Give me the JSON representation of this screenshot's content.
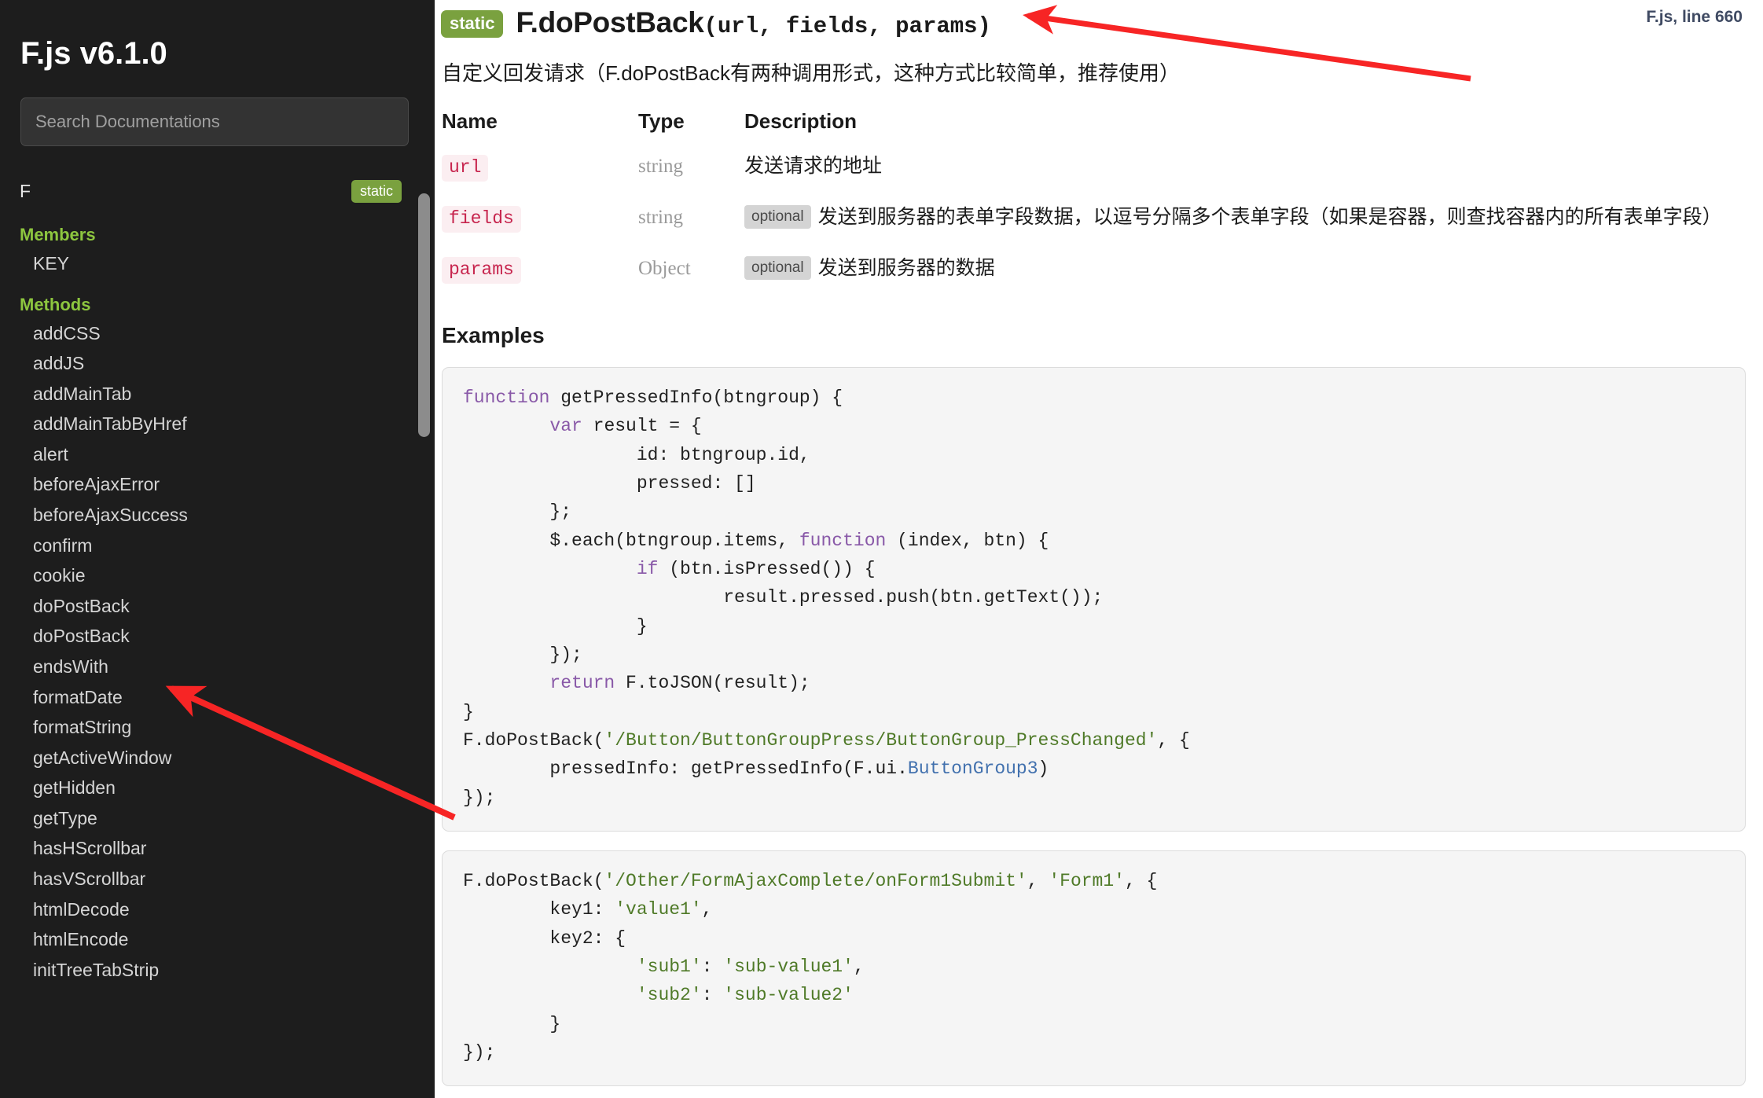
{
  "sidebar": {
    "brand": "F.js v6.1.0",
    "search": {
      "placeholder": "Search Documentations",
      "value": ""
    },
    "class_entry": {
      "name": "F",
      "badge": "static"
    },
    "groups": [
      {
        "title": "Members",
        "items": [
          "KEY"
        ]
      },
      {
        "title": "Methods",
        "items": [
          "addCSS",
          "addJS",
          "addMainTab",
          "addMainTabByHref",
          "alert",
          "beforeAjaxError",
          "beforeAjaxSuccess",
          "confirm",
          "cookie",
          "doPostBack",
          "doPostBack",
          "endsWith",
          "formatDate",
          "formatString",
          "getActiveWindow",
          "getHidden",
          "getType",
          "hasHScrollbar",
          "hasVScrollbar",
          "htmlDecode",
          "htmlEncode",
          "initTreeTabStrip"
        ]
      }
    ]
  },
  "main": {
    "badge_static": "static",
    "signature_name": "F.doPostBack",
    "signature_args": "(url, fields, params)",
    "source_link": "F.js, line 660",
    "description": "自定义回发请求（F.doPostBack有两种调用形式，这种方式比较简单，推荐使用）",
    "params_table": {
      "headers": [
        "Name",
        "Type",
        "Description"
      ],
      "rows": [
        {
          "name": "url",
          "type": "string",
          "optional": "",
          "description": "发送请求的地址"
        },
        {
          "name": "fields",
          "type": "string",
          "optional": "optional",
          "description": "发送到服务器的表单字段数据，以逗号分隔多个表单字段（如果是容器，则查找容器内的所有表单字段）"
        },
        {
          "name": "params",
          "type": "Object",
          "optional": "optional",
          "description": "发送到服务器的数据"
        }
      ]
    },
    "examples_title": "Examples",
    "example_1": "function getPressedInfo(btngroup) {\n        var result = {\n                id: btngroup.id,\n                pressed: []\n        };\n        $.each(btngroup.items, function (index, btn) {\n                if (btn.isPressed()) {\n                        result.pressed.push(btn.getText());\n                }\n        });\n        return F.toJSON(result);\n}\nF.doPostBack('/Button/ButtonGroupPress/ButtonGroup_PressChanged', {\n        pressedInfo: getPressedInfo(F.ui.ButtonGroup3)\n});",
    "example_2": "F.doPostBack('/Other/FormAjaxComplete/onForm1Submit', 'Form1', {\n        key1: 'value1',\n        key2: {\n                'sub1': 'sub-value1',\n                'sub2': 'sub-value2'\n        }\n});"
  },
  "annotations": {
    "arrow_1_label": "arrow pointing to F.doPostBack signature",
    "arrow_2_label": "arrow pointing to doPostBack sidebar item",
    "color": "#f72525"
  },
  "colors": {
    "sidebar_bg": "#1d1d1d",
    "accent_green": "#7aa13f",
    "group_green": "#8dc63f",
    "param_pink": "#c7254e",
    "code_bg": "#f5f5f5"
  }
}
